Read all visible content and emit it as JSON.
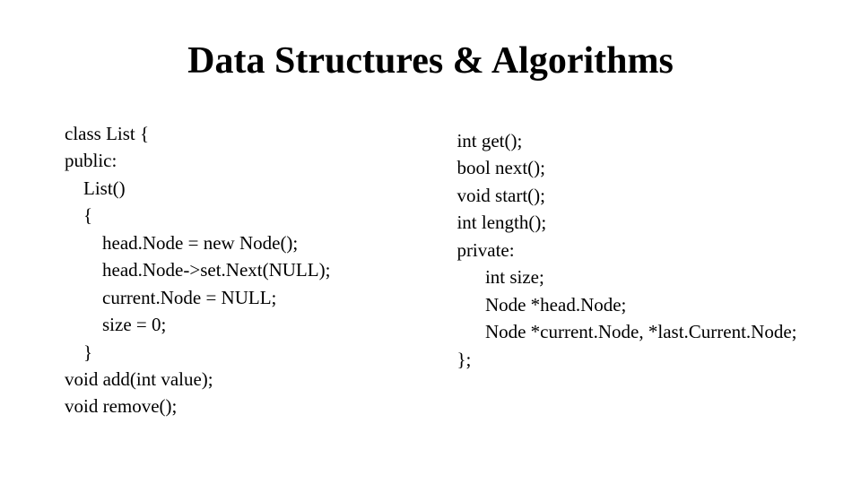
{
  "title": "Data Structures & Algorithms",
  "left_code": "class List {\npublic:\n    List()\n    {\n        head.Node = new Node();\n        head.Node->set.Next(NULL);\n        current.Node = NULL;\n        size = 0;\n    }\nvoid add(int value);\nvoid remove();",
  "right_code": "int get();\nbool next();\nvoid start();\nint length();\nprivate:\n      int size;\n      Node *head.Node;\n      Node *current.Node, *last.Current.Node;\n};"
}
